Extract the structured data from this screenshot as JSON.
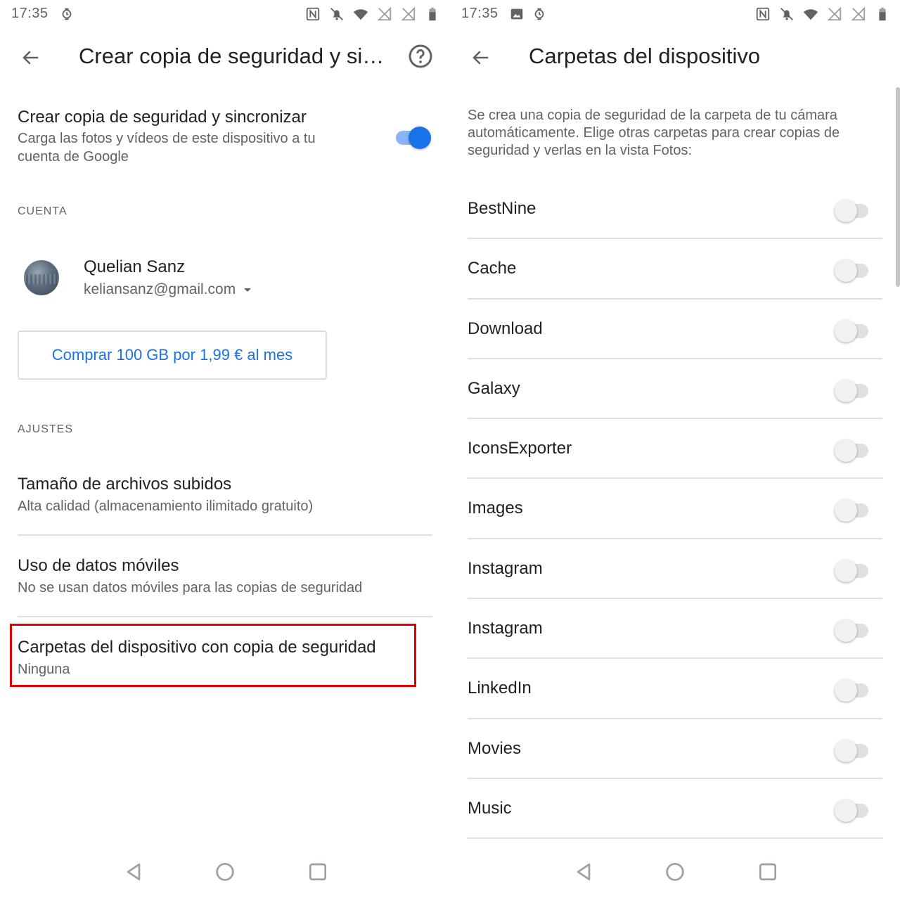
{
  "left": {
    "status": {
      "time": "17:35"
    },
    "appbar": {
      "title": "Crear copia de seguridad y sincronizar"
    },
    "backup": {
      "title": "Crear copia de seguridad y sincronizar",
      "description": "Carga las fotos y vídeos de este dispositivo a tu cuenta de Google",
      "enabled": true
    },
    "account_section": {
      "label": "CUENTA"
    },
    "account": {
      "name": "Quelian Sanz",
      "email": "keliansanz@gmail.com"
    },
    "buy_button": {
      "label": "Comprar 100 GB por 1,99 € al mes"
    },
    "settings_section": {
      "label": "AJUSTES"
    },
    "settings": [
      {
        "title": "Tamaño de archivos subidos",
        "subtitle": "Alta calidad (almacenamiento ilimitado gratuito)"
      },
      {
        "title": "Uso de datos móviles",
        "subtitle": "No se usan datos móviles para las copias de seguridad"
      },
      {
        "title": "Carpetas del dispositivo con copia de seguridad",
        "subtitle": "Ninguna"
      }
    ]
  },
  "right": {
    "status": {
      "time": "17:35"
    },
    "appbar": {
      "title": "Carpetas del dispositivo"
    },
    "description": "Se crea una copia de seguridad de la carpeta de tu cámara automáticamente. Elige otras carpetas para crear copias de seguridad y verlas en la vista Fotos:",
    "folders": [
      {
        "name": "BestNine",
        "enabled": false
      },
      {
        "name": "Cache",
        "enabled": false
      },
      {
        "name": "Download",
        "enabled": false
      },
      {
        "name": "Galaxy",
        "enabled": false
      },
      {
        "name": "IconsExporter",
        "enabled": false
      },
      {
        "name": "Images",
        "enabled": false
      },
      {
        "name": "Instagram",
        "enabled": false
      },
      {
        "name": "Instagram",
        "enabled": false
      },
      {
        "name": "LinkedIn",
        "enabled": false
      },
      {
        "name": "Movies",
        "enabled": false
      },
      {
        "name": "Music",
        "enabled": false
      }
    ]
  },
  "colors": {
    "accent": "#1a73e8",
    "highlight": "#e00000",
    "text_primary": "#202124",
    "text_secondary": "#5f6368"
  }
}
